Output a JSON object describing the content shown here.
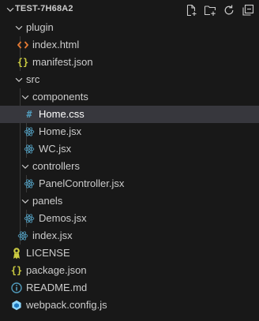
{
  "explorer": {
    "root_title": "TEST-7H68A2",
    "actions": [
      "new-file-icon",
      "new-folder-icon",
      "refresh-icon",
      "collapse-all-icon"
    ]
  },
  "tree": {
    "plugin": "plugin",
    "index_html": "index.html",
    "manifest_json": "manifest.json",
    "src": "src",
    "components": "components",
    "home_css": "Home.css",
    "home_jsx": "Home.jsx",
    "wc_jsx": "WC.jsx",
    "controllers": "controllers",
    "panelcontroller_jsx": "PanelController.jsx",
    "panels": "panels",
    "demos_jsx": "Demos.jsx",
    "index_jsx": "index.jsx",
    "license": "LICENSE",
    "package_json": "package.json",
    "readme_md": "README.md",
    "webpack_config_js": "webpack.config.js"
  },
  "icon_glyphs": {
    "css": "#",
    "json": "{}"
  },
  "colors": {
    "background": "#181818",
    "selected_row": "#37373d",
    "text": "#cccccc",
    "html_icon": "#e37933",
    "json_icon": "#cbcb41",
    "css_icon": "#519aba",
    "react_icon": "#519aba",
    "license_icon": "#cbcb41",
    "markdown_icon": "#519aba",
    "webpack_icon": "#8ed6fb"
  }
}
